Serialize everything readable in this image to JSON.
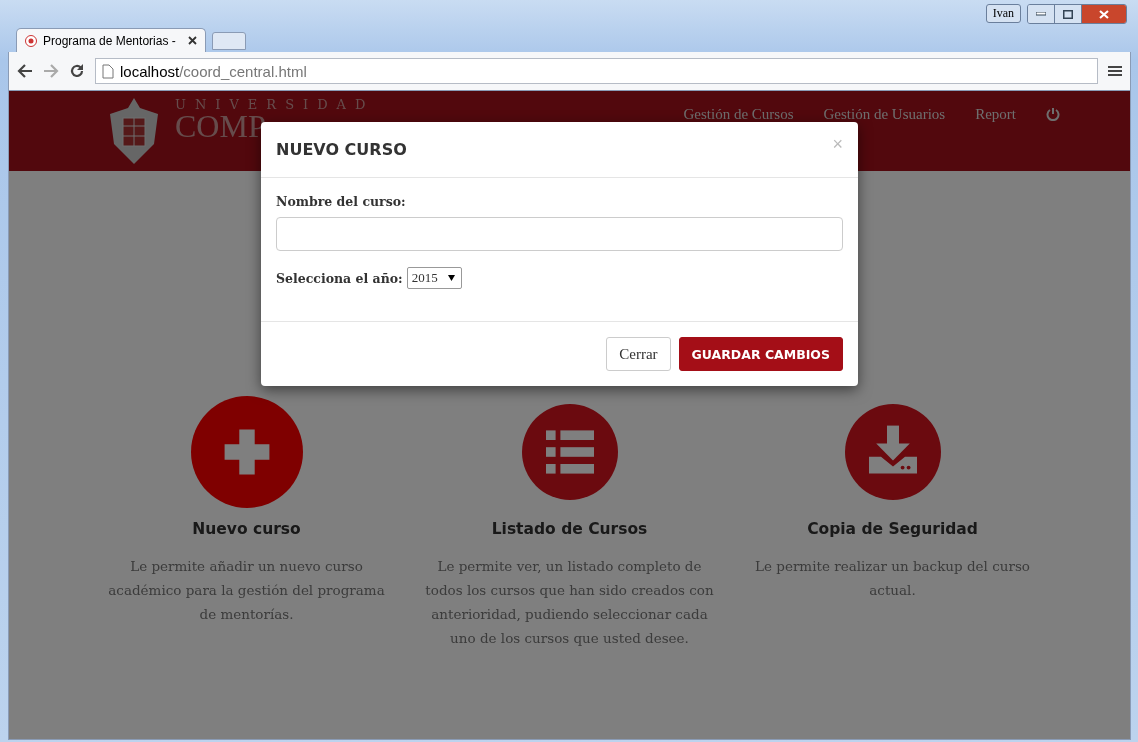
{
  "browser": {
    "tab_title": "Programa de Mentorias - ",
    "user": "Ivan",
    "address": {
      "host": "localhost",
      "path": "/coord_central.html"
    }
  },
  "site": {
    "logo": {
      "line1": "UNIVERSIDAD",
      "line2": "COMP"
    },
    "nav": [
      "Gestión de Cursos",
      "Gestión de Usuarios",
      "Report"
    ]
  },
  "features": [
    {
      "kind": "plus",
      "highlighted": true,
      "title": "Nuevo curso",
      "description": "Le permite añadir un nuevo curso académico para la gestión del programa de mentorías."
    },
    {
      "kind": "list",
      "highlighted": false,
      "title": "Listado de Cursos",
      "description": "Le permite ver, un listado completo de todos los cursos que han sido creados con anterioridad, pudiendo seleccionar cada uno de los cursos que usted desee."
    },
    {
      "kind": "download",
      "highlighted": false,
      "title": "Copia de Seguridad",
      "description": "Le permite realizar un backup del curso actual."
    }
  ],
  "modal": {
    "title": "NUEVO CURSO",
    "close": "×",
    "name_label": "Nombre del curso:",
    "year_label": "Selecciona el año:",
    "year_value": "2015",
    "buttons": [
      {
        "label": "Cerrar",
        "kind": "secondary"
      },
      {
        "label": "GUARDAR CAMBIOS",
        "kind": "primary"
      }
    ]
  }
}
